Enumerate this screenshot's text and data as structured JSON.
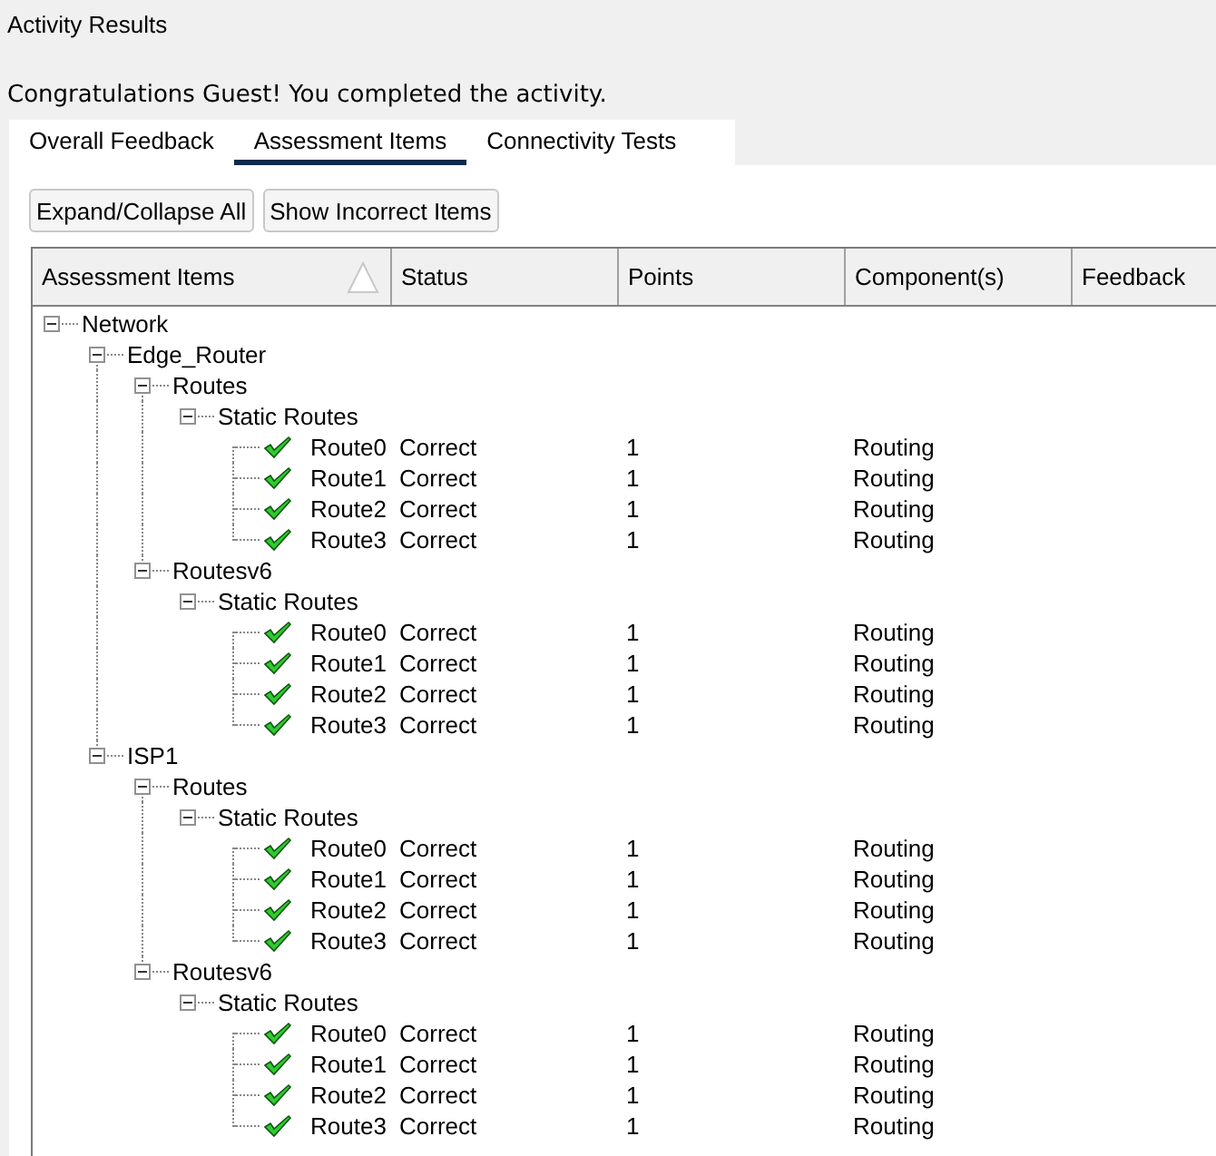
{
  "window": {
    "title": "Activity Results"
  },
  "message": "Congratulations Guest! You completed the activity.",
  "tabs": [
    {
      "label": "Overall Feedback",
      "selected": false
    },
    {
      "label": "Assessment Items",
      "selected": true
    },
    {
      "label": "Connectivity Tests",
      "selected": false
    }
  ],
  "buttons": [
    "Expand/Collapse All",
    "Show Incorrect Items"
  ],
  "table": {
    "columns": [
      "Assessment Items",
      "Status",
      "Points",
      "Component(s)",
      "Feedback"
    ],
    "tree": [
      {
        "label": "Network",
        "expanded": true,
        "children": [
          {
            "label": "Edge_Router",
            "expanded": true,
            "children": [
              {
                "label": "Routes",
                "expanded": true,
                "children": [
                  {
                    "label": "Static Routes",
                    "expanded": true,
                    "children": [
                      {
                        "label": "Route0",
                        "correct": true,
                        "status": "Correct",
                        "score": "1",
                        "component": "Routing"
                      },
                      {
                        "label": "Route1",
                        "correct": true,
                        "status": "Correct",
                        "score": "1",
                        "component": "Routing"
                      },
                      {
                        "label": "Route2",
                        "correct": true,
                        "status": "Correct",
                        "score": "1",
                        "component": "Routing"
                      },
                      {
                        "label": "Route3",
                        "correct": true,
                        "status": "Correct",
                        "score": "1",
                        "component": "Routing"
                      }
                    ]
                  }
                ]
              },
              {
                "label": "Routesv6",
                "expanded": true,
                "children": [
                  {
                    "label": "Static Routes",
                    "expanded": true,
                    "children": [
                      {
                        "label": "Route0",
                        "correct": true,
                        "status": "Correct",
                        "score": "1",
                        "component": "Routing"
                      },
                      {
                        "label": "Route1",
                        "correct": true,
                        "status": "Correct",
                        "score": "1",
                        "component": "Routing"
                      },
                      {
                        "label": "Route2",
                        "correct": true,
                        "status": "Correct",
                        "score": "1",
                        "component": "Routing"
                      },
                      {
                        "label": "Route3",
                        "correct": true,
                        "status": "Correct",
                        "score": "1",
                        "component": "Routing"
                      }
                    ]
                  }
                ]
              }
            ]
          },
          {
            "label": "ISP1",
            "expanded": true,
            "children": [
              {
                "label": "Routes",
                "expanded": true,
                "children": [
                  {
                    "label": "Static Routes",
                    "expanded": true,
                    "children": [
                      {
                        "label": "Route0",
                        "correct": true,
                        "status": "Correct",
                        "score": "1",
                        "component": "Routing"
                      },
                      {
                        "label": "Route1",
                        "correct": true,
                        "status": "Correct",
                        "score": "1",
                        "component": "Routing"
                      },
                      {
                        "label": "Route2",
                        "correct": true,
                        "status": "Correct",
                        "score": "1",
                        "component": "Routing"
                      },
                      {
                        "label": "Route3",
                        "correct": true,
                        "status": "Correct",
                        "score": "1",
                        "component": "Routing"
                      }
                    ]
                  }
                ]
              },
              {
                "label": "Routesv6",
                "expanded": true,
                "children": [
                  {
                    "label": "Static Routes",
                    "expanded": true,
                    "children": [
                      {
                        "label": "Route0",
                        "correct": true,
                        "status": "Correct",
                        "score": "1",
                        "component": "Routing"
                      },
                      {
                        "label": "Route1",
                        "correct": true,
                        "status": "Correct",
                        "score": "1",
                        "component": "Routing"
                      },
                      {
                        "label": "Route2",
                        "correct": true,
                        "status": "Correct",
                        "score": "1",
                        "component": "Routing"
                      },
                      {
                        "label": "Route3",
                        "correct": true,
                        "status": "Correct",
                        "score": "1",
                        "component": "Routing"
                      }
                    ]
                  }
                ]
              }
            ]
          }
        ]
      }
    ]
  }
}
